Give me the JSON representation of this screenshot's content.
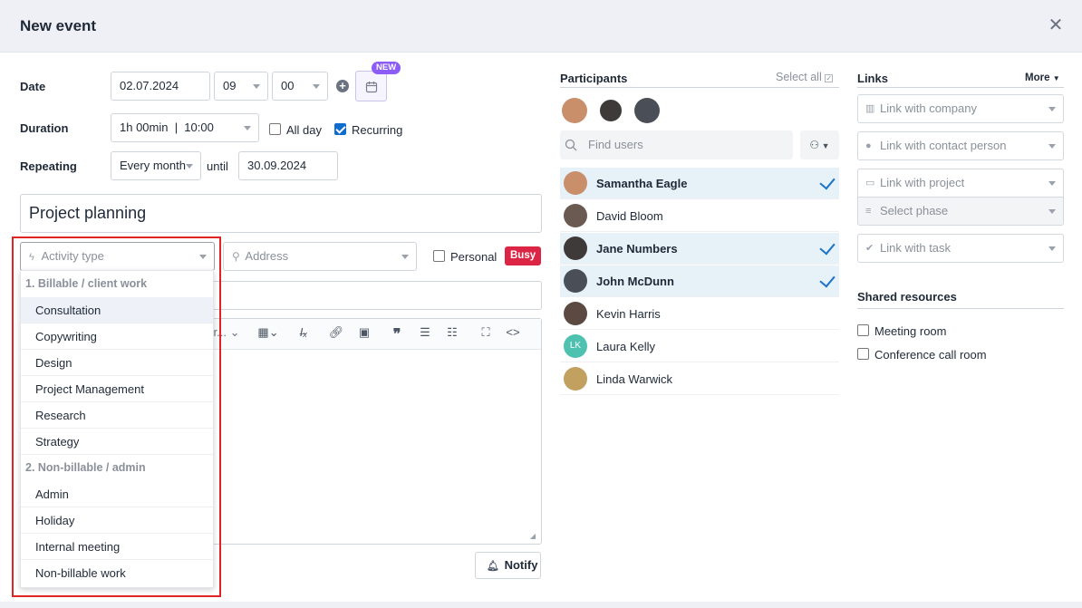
{
  "header": {
    "title": "New event",
    "close_icon": "close-icon"
  },
  "form": {
    "date_label": "Date",
    "date_value": "02.07.2024",
    "hour_value": "09",
    "minute_value": "00",
    "new_badge": "NEW",
    "duration_label": "Duration",
    "duration_value": "1h 00min  |  10:00",
    "allday_label": "All day",
    "allday_checked": false,
    "recurring_label": "Recurring",
    "recurring_checked": true,
    "repeating_label": "Repeating",
    "repeating_value": "Every month",
    "until_label": "until",
    "until_value": "30.09.2024",
    "title_value": "Project planning",
    "activity_placeholder": "Activity type",
    "address_placeholder": "Address",
    "personal_label": "Personal",
    "busy_label": "Busy",
    "toolbar_font_fragment": "r...",
    "notify_label": "Notify"
  },
  "activity_dropdown": {
    "groups": [
      {
        "label": "1. Billable / client work",
        "items": [
          "Consultation",
          "Copywriting",
          "Design",
          "Project Management",
          "Research",
          "Strategy"
        ]
      },
      {
        "label": "2. Non-billable / admin",
        "items": [
          "Admin",
          "Holiday",
          "Internal meeting",
          "Non-billable work"
        ]
      }
    ],
    "highlighted": "Consultation"
  },
  "participants": {
    "title": "Participants",
    "select_all": "Select all",
    "search_placeholder": "Find users",
    "list": [
      {
        "name": "Samantha Eagle",
        "selected": true,
        "color": "#c98f6b"
      },
      {
        "name": "David Bloom",
        "selected": false,
        "color": "#6b5a52"
      },
      {
        "name": "Jane Numbers",
        "selected": true,
        "color": "#3f3a3a"
      },
      {
        "name": "John McDunn",
        "selected": true,
        "color": "#4a4e56"
      },
      {
        "name": "Kevin Harris",
        "selected": false,
        "color": "#5c4a42"
      },
      {
        "name": "Laura Kelly",
        "selected": false,
        "initials": "LK",
        "color": "#4fc1b0"
      },
      {
        "name": "Linda Warwick",
        "selected": false,
        "color": "#c2a05f"
      }
    ]
  },
  "links": {
    "title": "Links",
    "more_label": "More",
    "items": [
      "Link with company",
      "Link with contact person",
      "Link with project",
      "Select phase",
      "Link with task"
    ]
  },
  "shared_resources": {
    "title": "Shared resources",
    "items": [
      "Meeting room",
      "Conference call room"
    ]
  },
  "colors": {
    "accent": "#0f6ccf",
    "busy": "#dc2545",
    "badge": "#8b5cf6",
    "highlight": "#e7f1f8",
    "frame": "#e02424"
  }
}
